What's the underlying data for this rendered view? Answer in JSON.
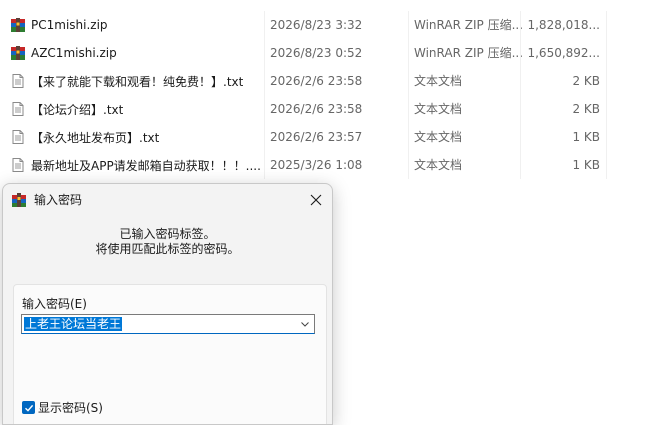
{
  "files": [
    {
      "name": "PC1mishi.zip",
      "date": "2026/8/23 3:32",
      "type": "WinRAR ZIP 压缩...",
      "size": "1,828,018...",
      "icon": "winrar-archive-icon"
    },
    {
      "name": "AZC1mishi.zip",
      "date": "2026/8/23 0:52",
      "type": "WinRAR ZIP 压缩...",
      "size": "1,650,892...",
      "icon": "winrar-archive-icon"
    },
    {
      "name": "【来了就能下载和观看！纯免费！】.txt",
      "date": "2026/2/6 23:58",
      "type": "文本文档",
      "size": "2 KB",
      "icon": "text-file-icon"
    },
    {
      "name": "【论坛介绍】.txt",
      "date": "2026/2/6 23:58",
      "type": "文本文档",
      "size": "2 KB",
      "icon": "text-file-icon"
    },
    {
      "name": "【永久地址发布页】.txt",
      "date": "2026/2/6 23:57",
      "type": "文本文档",
      "size": "1 KB",
      "icon": "text-file-icon"
    },
    {
      "name": "最新地址及APP请发邮箱自动获取！！！....",
      "date": "2025/3/26 1:08",
      "type": "文本文档",
      "size": "1 KB",
      "icon": "text-file-icon"
    }
  ],
  "dialog": {
    "title": "输入密码",
    "info_line1": "已输入密码标签。",
    "info_line2": "将使用匹配此标签的密码。",
    "password_label": "输入密码(E)",
    "password_value": "上老王论坛当老王",
    "show_password_label": "显示密码(S)",
    "show_password_checked": true
  },
  "colors": {
    "accent": "#0067c0",
    "selection": "#0078d7",
    "secondary_text": "#666666"
  }
}
